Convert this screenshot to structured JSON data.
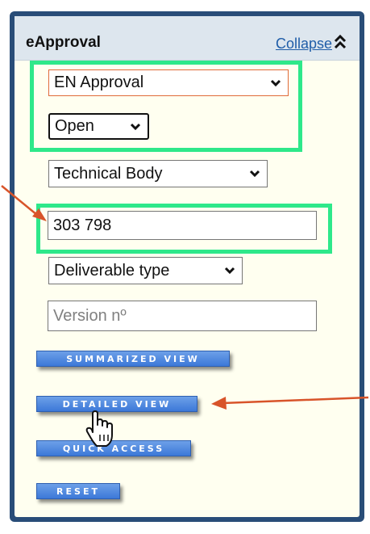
{
  "header": {
    "title": "eApproval",
    "collapse_label": "Collapse"
  },
  "filters": {
    "approval_type": "EN Approval",
    "status": "Open",
    "technical_body": "Technical Body",
    "deliverable_number": "303 798",
    "deliverable_type": "Deliverable type",
    "version_placeholder": "Version nº"
  },
  "buttons": {
    "summarized": "SUMMARIZED VIEW",
    "detailed": "DETAILED VIEW",
    "quick": "QUICK ACCESS",
    "reset": "RESET"
  },
  "colors": {
    "highlight": "#2ee88a",
    "arrow": "#d8542a",
    "panel_border": "#294d78"
  }
}
